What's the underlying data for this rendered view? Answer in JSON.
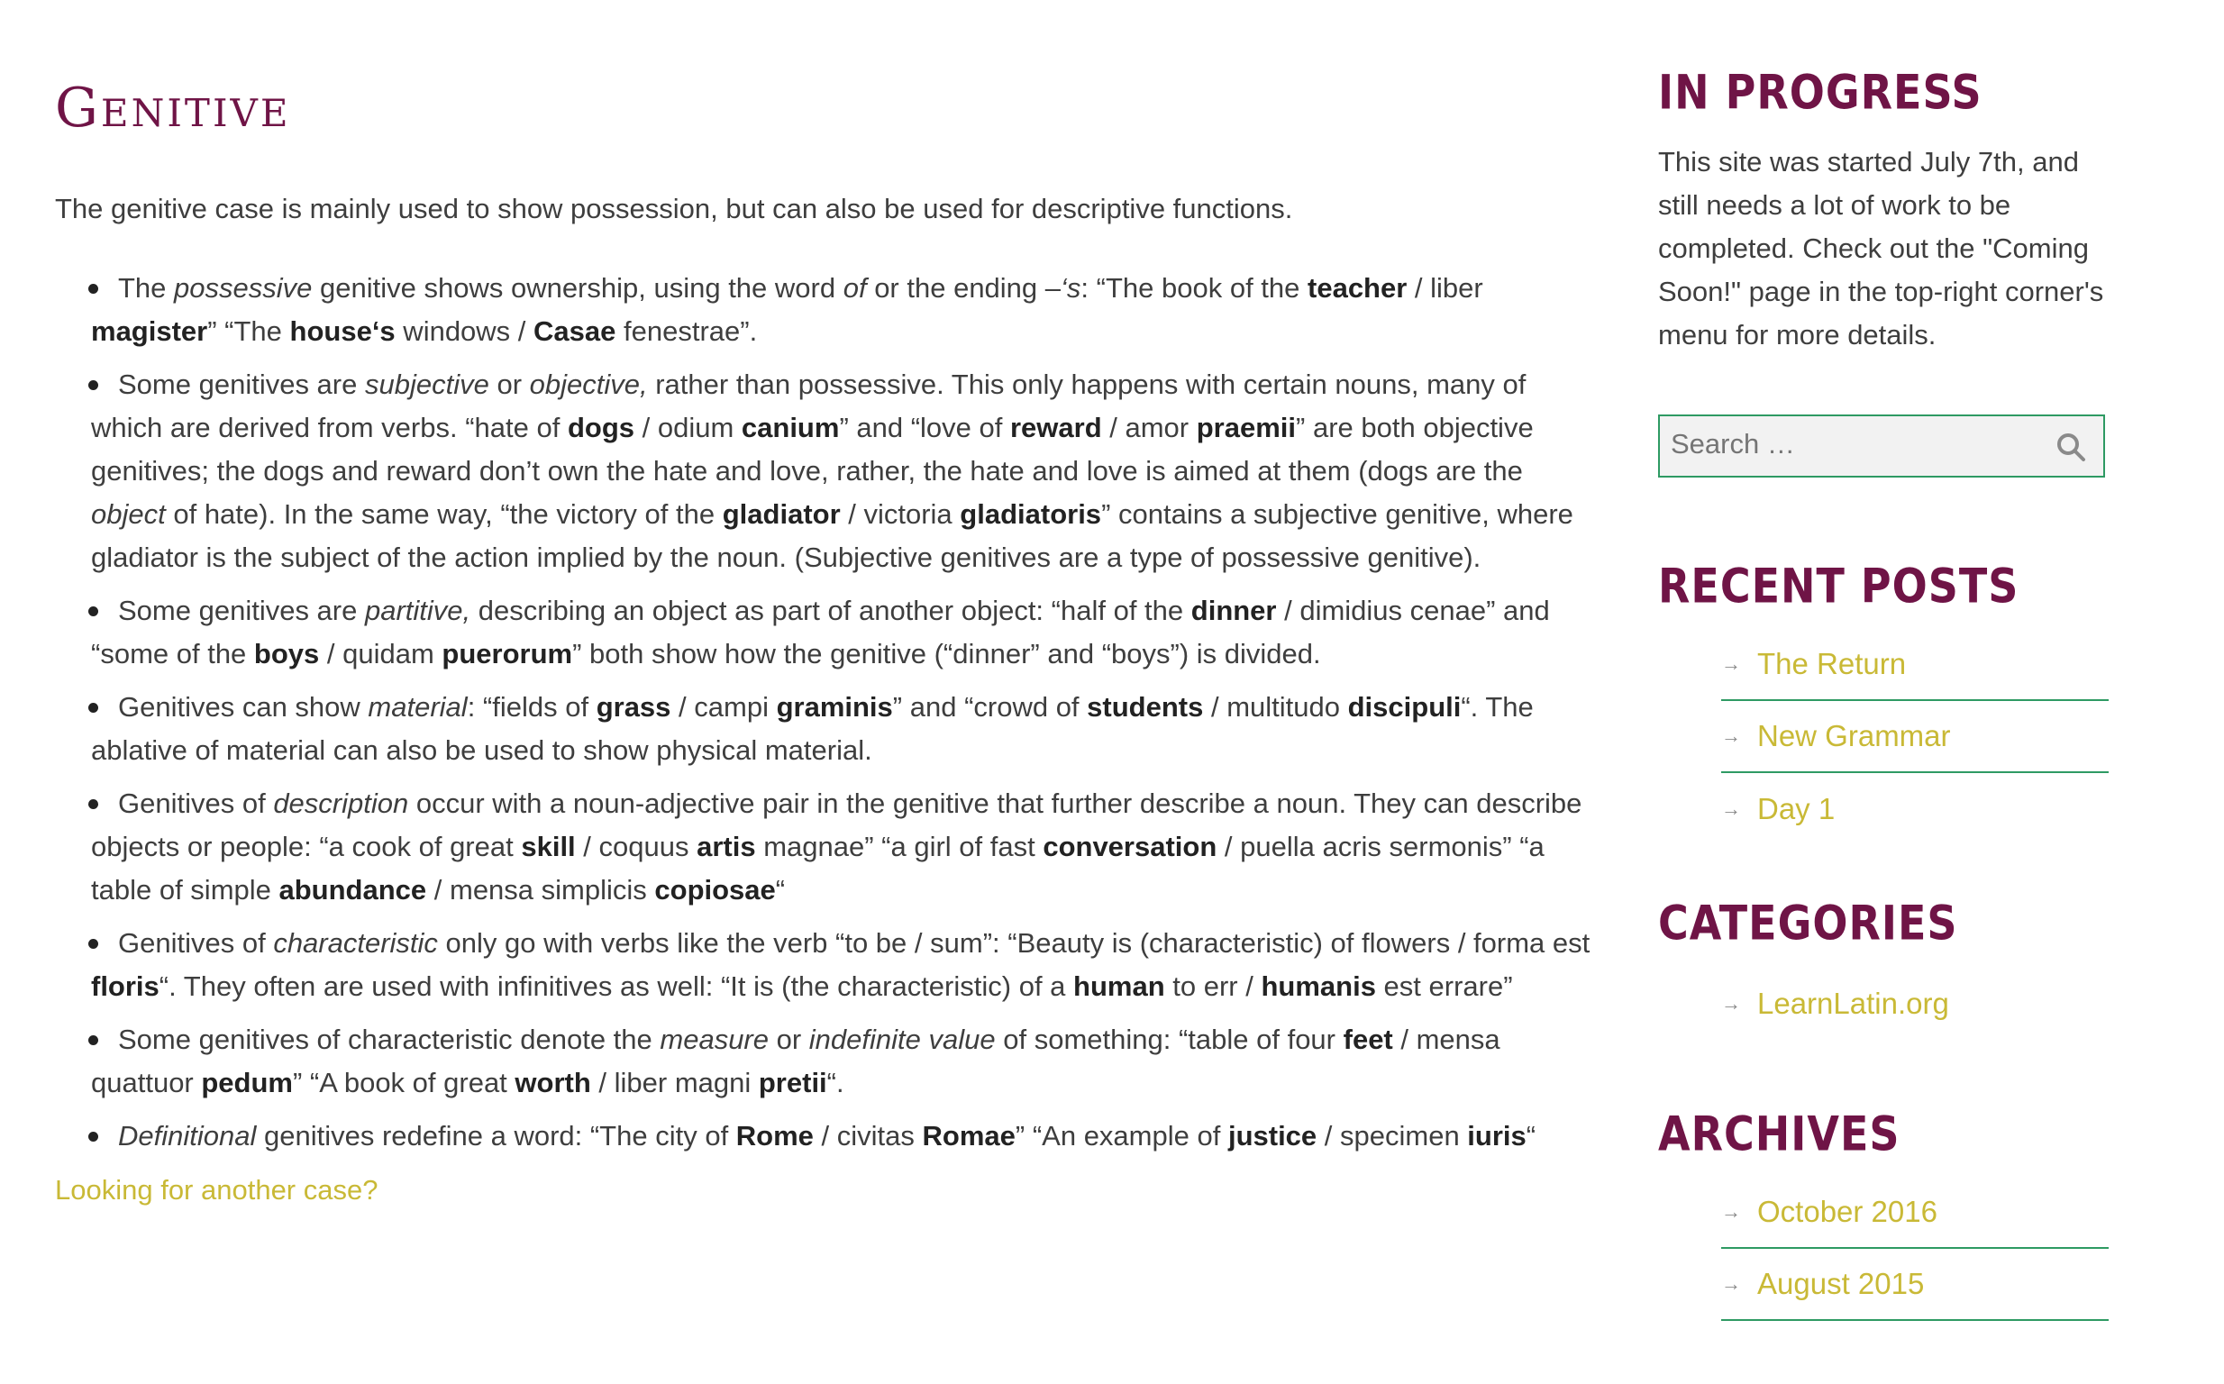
{
  "page": {
    "title": "Genitive",
    "intro": "The genitive case is mainly used to show possession, but can also be used for descriptive functions.",
    "more_link": "Looking for another case?"
  },
  "items": [
    [
      {
        "t": "The ",
        "s": "n"
      },
      {
        "t": "possessive",
        "s": "i"
      },
      {
        "t": " genitive shows ownership, using the word ",
        "s": "n"
      },
      {
        "t": "of",
        "s": "i"
      },
      {
        "t": " or the ending –",
        "s": "n"
      },
      {
        "t": "‘s",
        "s": "i"
      },
      {
        "t": ": “The book of the ",
        "s": "n"
      },
      {
        "t": "teacher",
        "s": "b"
      },
      {
        "t": " / liber ",
        "s": "n"
      },
      {
        "t": "magister",
        "s": "b"
      },
      {
        "t": "” “The ",
        "s": "n"
      },
      {
        "t": "house‘s",
        "s": "b"
      },
      {
        "t": " windows / ",
        "s": "n"
      },
      {
        "t": "Casae",
        "s": "b"
      },
      {
        "t": " fenestrae”.",
        "s": "n"
      }
    ],
    [
      {
        "t": "Some genitives are ",
        "s": "n"
      },
      {
        "t": "subjective",
        "s": "i"
      },
      {
        "t": " or ",
        "s": "n"
      },
      {
        "t": "objective,",
        "s": "i"
      },
      {
        "t": " rather than possessive. This only happens with certain nouns, many of which are derived from verbs. “hate of ",
        "s": "n"
      },
      {
        "t": "dogs",
        "s": "b"
      },
      {
        "t": " / odium ",
        "s": "n"
      },
      {
        "t": "canium",
        "s": "b"
      },
      {
        "t": "” and “love of ",
        "s": "n"
      },
      {
        "t": "reward",
        "s": "b"
      },
      {
        "t": " / amor ",
        "s": "n"
      },
      {
        "t": "praemii",
        "s": "b"
      },
      {
        "t": "” are both objective genitives; the dogs and reward don’t own the hate and love, rather, the hate and love is aimed at them (dogs are the ",
        "s": "n"
      },
      {
        "t": "object",
        "s": "i"
      },
      {
        "t": " of hate). In the same way, “the victory of the ",
        "s": "n"
      },
      {
        "t": "gladiator",
        "s": "b"
      },
      {
        "t": " / victoria ",
        "s": "n"
      },
      {
        "t": "gladiatoris",
        "s": "b"
      },
      {
        "t": "” contains a subjective genitive, where gladiator is the subject of the action implied by the noun. (Subjective genitives are a type of possessive genitive).",
        "s": "n"
      }
    ],
    [
      {
        "t": "Some genitives are ",
        "s": "n"
      },
      {
        "t": "partitive,",
        "s": "i"
      },
      {
        "t": " describing an object as part of another object: “half of the ",
        "s": "n"
      },
      {
        "t": "dinner",
        "s": "b"
      },
      {
        "t": " / dimidius cenae” and “some of the ",
        "s": "n"
      },
      {
        "t": "boys",
        "s": "b"
      },
      {
        "t": " / quidam ",
        "s": "n"
      },
      {
        "t": "puerorum",
        "s": "b"
      },
      {
        "t": "” both show how the genitive (“dinner” and “boys”) is divided.",
        "s": "n"
      }
    ],
    [
      {
        "t": "Genitives can show ",
        "s": "n"
      },
      {
        "t": "material",
        "s": "i"
      },
      {
        "t": ": “fields of ",
        "s": "n"
      },
      {
        "t": "grass",
        "s": "b"
      },
      {
        "t": " / campi ",
        "s": "n"
      },
      {
        "t": "graminis",
        "s": "b"
      },
      {
        "t": "” and “crowd of ",
        "s": "n"
      },
      {
        "t": "students",
        "s": "b"
      },
      {
        "t": " / multitudo ",
        "s": "n"
      },
      {
        "t": "discipuli",
        "s": "b"
      },
      {
        "t": "“. The ablative of material can also be used to show physical material.",
        "s": "n"
      }
    ],
    [
      {
        "t": "Genitives of ",
        "s": "n"
      },
      {
        "t": "description",
        "s": "i"
      },
      {
        "t": " occur with a noun-adjective pair in the genitive that further describe a noun. They can describe objects or people: “a cook of great ",
        "s": "n"
      },
      {
        "t": "skill",
        "s": "b"
      },
      {
        "t": " /  coquus ",
        "s": "n"
      },
      {
        "t": "artis",
        "s": "b"
      },
      {
        "t": " magnae” “a girl of fast ",
        "s": "n"
      },
      {
        "t": "conversation",
        "s": "b"
      },
      {
        "t": " / puella acris sermonis” “a table of simple ",
        "s": "n"
      },
      {
        "t": "abundance",
        "s": "b"
      },
      {
        "t": " / mensa simplicis ",
        "s": "n"
      },
      {
        "t": "copiosae",
        "s": "b"
      },
      {
        "t": "“",
        "s": "n"
      }
    ],
    [
      {
        "t": "Genitives of ",
        "s": "n"
      },
      {
        "t": "characteristic",
        "s": "i"
      },
      {
        "t": " only go with verbs like the verb “to be / sum”: “Beauty is (characteristic) of flowers / forma est ",
        "s": "n"
      },
      {
        "t": "floris",
        "s": "b"
      },
      {
        "t": "“. They often are used with infinitives as well: “It is (the characteristic) of a ",
        "s": "n"
      },
      {
        "t": "human",
        "s": "b"
      },
      {
        "t": " to err / ",
        "s": "n"
      },
      {
        "t": "humanis",
        "s": "b"
      },
      {
        "t": " est errare”",
        "s": "n"
      }
    ],
    [
      {
        "t": "Some genitives of characteristic denote the ",
        "s": "n"
      },
      {
        "t": "measure",
        "s": "i"
      },
      {
        "t": " or ",
        "s": "n"
      },
      {
        "t": "indefinite value",
        "s": "i"
      },
      {
        "t": " of something: “table of four ",
        "s": "n"
      },
      {
        "t": "feet",
        "s": "b"
      },
      {
        "t": " / mensa quattuor ",
        "s": "n"
      },
      {
        "t": "pedum",
        "s": "b"
      },
      {
        "t": "” “A book of great ",
        "s": "n"
      },
      {
        "t": "worth",
        "s": "b"
      },
      {
        "t": " / liber magni ",
        "s": "n"
      },
      {
        "t": "pretii",
        "s": "b"
      },
      {
        "t": "“.",
        "s": "n"
      }
    ],
    [
      {
        "t": "Definitional",
        "s": "i"
      },
      {
        "t": " genitives redefine a word: “The city of ",
        "s": "n"
      },
      {
        "t": "Rome",
        "s": "b"
      },
      {
        "t": " / civitas ",
        "s": "n"
      },
      {
        "t": "Romae",
        "s": "b"
      },
      {
        "t": "” “An example of ",
        "s": "n"
      },
      {
        "t": "justice",
        "s": "b"
      },
      {
        "t": " / specimen ",
        "s": "n"
      },
      {
        "t": "iuris",
        "s": "b"
      },
      {
        "t": "“",
        "s": "n"
      }
    ]
  ],
  "sidebar": {
    "progress_title": "IN PROGRESS",
    "progress_text": "This site was started July 7th, and still needs a lot of work to be completed. Check out the \"Coming Soon!\" page in the top-right corner's menu for more details.",
    "search_placeholder": "Search …",
    "recent_title": "RECENT POSTS",
    "recent_posts": [
      "The Return",
      "New Grammar",
      "Day 1"
    ],
    "categories_title": "CATEGORIES",
    "categories": [
      "LearnLatin.org"
    ],
    "archives_title": "ARCHIVES",
    "archives": [
      "October 2016",
      "August 2015"
    ],
    "arrow": "→"
  },
  "colors": {
    "title": "#6f1446",
    "link": "#c9b936",
    "accent_border": "#2e9a63"
  },
  "icons": {
    "search": "search-icon",
    "list_arrow": "arrow-right-icon"
  }
}
